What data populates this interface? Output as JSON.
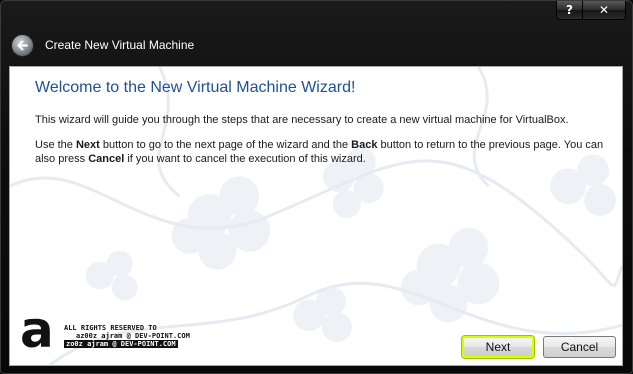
{
  "window": {
    "title": "Create New Virtual Machine",
    "help_label": "?",
    "close_label": "✕"
  },
  "wizard": {
    "heading": "Welcome to the New Virtual Machine Wizard!",
    "intro": "This wizard will guide you through the steps that are necessary to create a new virtual machine for VirtualBox.",
    "instructions": {
      "t1": "Use the ",
      "next_word": "Next",
      "t2": " button to go to the next page of the wizard and the ",
      "back_word": "Back",
      "t3": " button to return to the previous page. You can also press ",
      "cancel_word": "Cancel",
      "t4": " if you want to cancel the execution of this wizard."
    }
  },
  "watermark": {
    "letter": "a",
    "line1": "ALL RIGHTS RESERVED TO",
    "line2": "az00z ajram @ DEV-POINT.COM",
    "line3": "zo0z ajram @ DEV-POINT.COM"
  },
  "buttons": {
    "next": "Next",
    "cancel": "Cancel"
  },
  "colors": {
    "accent_heading": "#1f4f9a",
    "focus_ring": "#d8ff00",
    "frame": "#0d0d0d"
  }
}
